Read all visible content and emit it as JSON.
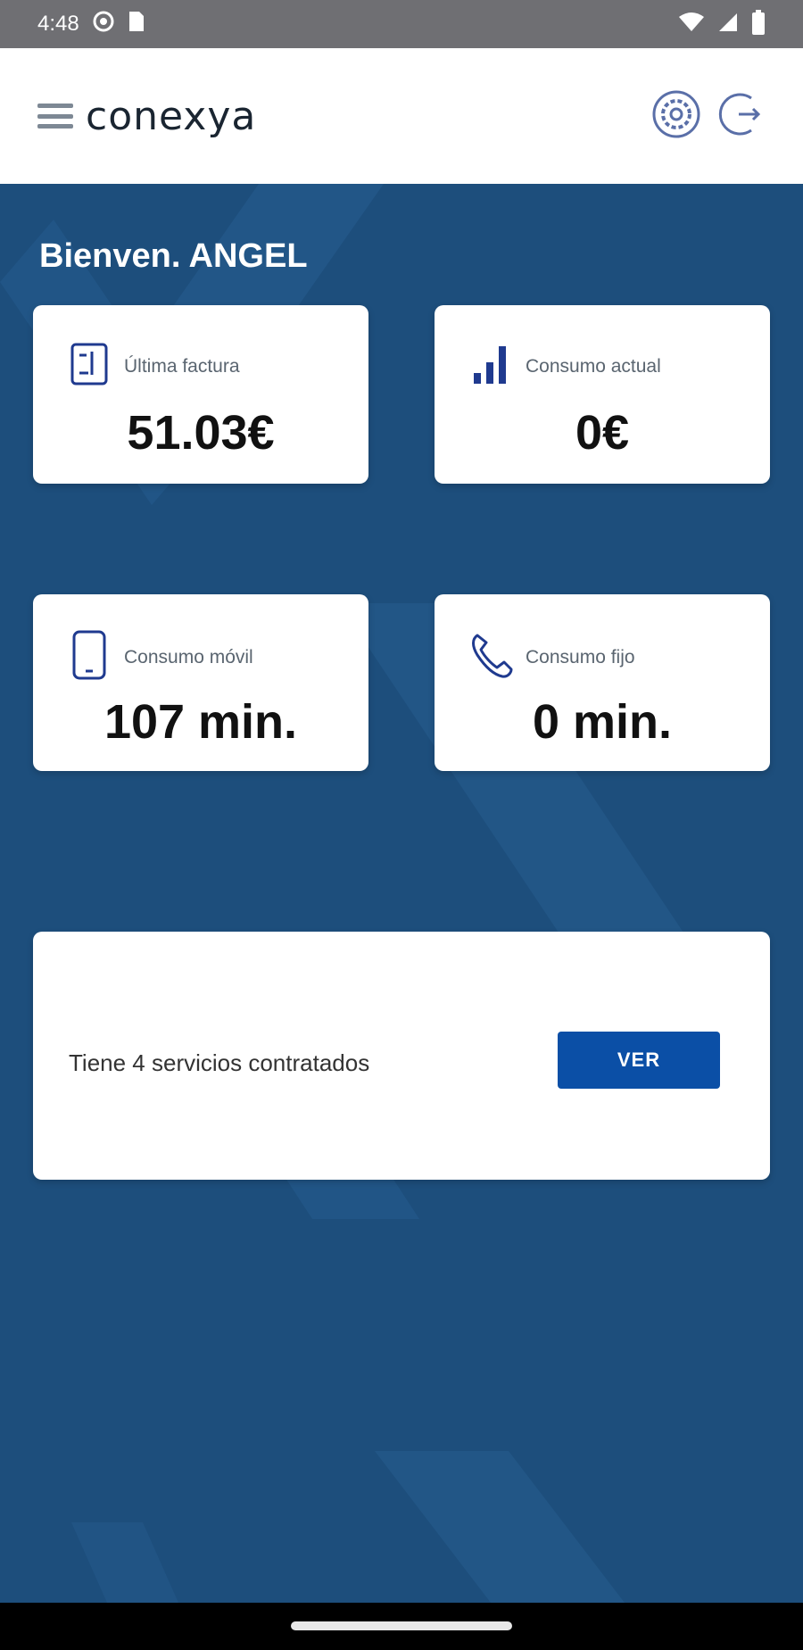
{
  "status_bar": {
    "time": "4:48"
  },
  "header": {
    "logo": "conexya"
  },
  "main": {
    "greeting": "Bienven. ANGEL",
    "cards": [
      {
        "label": "Última factura",
        "value": "51.03€",
        "icon": "invoice-icon"
      },
      {
        "label": "Consumo actual",
        "value": "0€",
        "icon": "signal-bars-icon"
      },
      {
        "label": "Consumo móvil",
        "value": "107 min.",
        "icon": "smartphone-icon"
      },
      {
        "label": "Consumo fijo",
        "value": "0 min.",
        "icon": "phone-icon"
      }
    ],
    "services": {
      "text": "Tiene 4 servicios contratados",
      "button_label": "VER"
    }
  },
  "colors": {
    "background": "#1d4e7c",
    "accent": "#0b4fa6",
    "card": "#ffffff",
    "icon": "#1f3a8f"
  }
}
